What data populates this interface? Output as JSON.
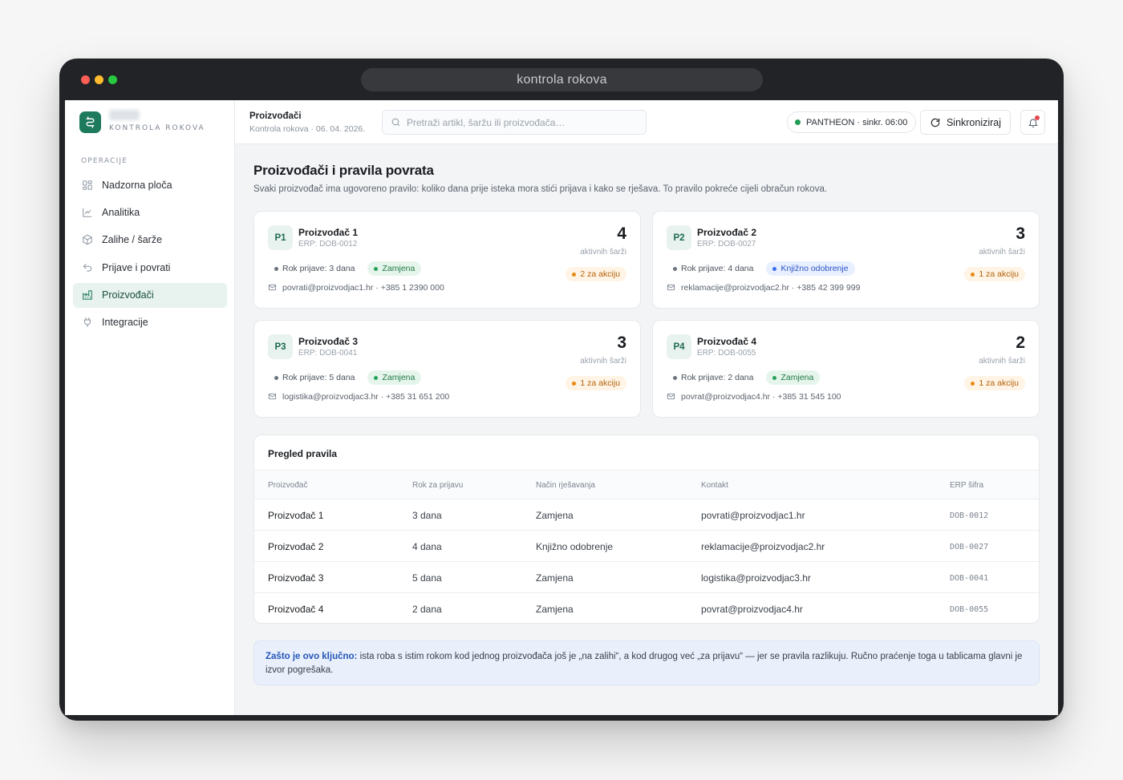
{
  "window": {
    "url": "kontrola rokova"
  },
  "brand": {
    "subtitle": "KONTROLA ROKOVA"
  },
  "sidebar": {
    "heading": "OPERACIJE",
    "items": [
      {
        "label": "Nadzorna ploča",
        "icon": "dashboard-grid-icon",
        "active": false
      },
      {
        "label": "Analitika",
        "icon": "chart-line-icon",
        "active": false
      },
      {
        "label": "Zalihe / šarže",
        "icon": "box-icon",
        "active": false
      },
      {
        "label": "Prijave i povrati",
        "icon": "return-arrow-icon",
        "active": false
      },
      {
        "label": "Proizvođači",
        "icon": "factory-icon",
        "active": true
      },
      {
        "label": "Integracije",
        "icon": "plug-icon",
        "active": false
      }
    ]
  },
  "topbar": {
    "title": "Proizvođači",
    "subtitle": "Kontrola rokova · 06. 04. 2026.",
    "search_placeholder": "Pretraži artikl, šaržu ili proizvođača…",
    "status": "PANTHEON · sinkr. 06:00",
    "sync_label": "Sinkroniziraj"
  },
  "page": {
    "title": "Proizvođači i pravila povrata",
    "description": "Svaki proizvođač ima ugovoreno pravilo: koliko dana prije isteka mora stići prijava i kako se rješava. To pravilo pokreće cijeli obračun rokova."
  },
  "cards": [
    {
      "tag": "P1",
      "name": "Proizvođač 1",
      "erp": "ERP: DOB-0012",
      "deadline": "Rok prijave: 3 dana",
      "method": "Zamjena",
      "method_color": "green",
      "contact": "povrati@proizvodjac1.hr · +385 1 2390 000",
      "count": "4",
      "count_label": "aktivnih šarži",
      "action": "2 za akciju"
    },
    {
      "tag": "P2",
      "name": "Proizvođač 2",
      "erp": "ERP: DOB-0027",
      "deadline": "Rok prijave: 4 dana",
      "method": "Knjižno odobrenje",
      "method_color": "blue",
      "contact": "reklamacije@proizvodjac2.hr · +385 42 399 999",
      "count": "3",
      "count_label": "aktivnih šarži",
      "action": "1 za akciju"
    },
    {
      "tag": "P3",
      "name": "Proizvođač 3",
      "erp": "ERP: DOB-0041",
      "deadline": "Rok prijave: 5 dana",
      "method": "Zamjena",
      "method_color": "green",
      "contact": "logistika@proizvodjac3.hr · +385 31 651 200",
      "count": "3",
      "count_label": "aktivnih šarži",
      "action": "1 za akciju"
    },
    {
      "tag": "P4",
      "name": "Proizvođač 4",
      "erp": "ERP: DOB-0055",
      "deadline": "Rok prijave: 2 dana",
      "method": "Zamjena",
      "method_color": "green",
      "contact": "povrat@proizvodjac4.hr · +385 31 545 100",
      "count": "2",
      "count_label": "aktivnih šarži",
      "action": "1 za akciju"
    }
  ],
  "rules_table": {
    "title": "Pregled pravila",
    "headers": [
      "Proizvođač",
      "Rok za prijavu",
      "Način rješavanja",
      "Kontakt",
      "ERP šifra"
    ],
    "rows": [
      [
        "Proizvođač 1",
        "3 dana",
        "Zamjena",
        "povrati@proizvodjac1.hr",
        "DOB-0012"
      ],
      [
        "Proizvođač 2",
        "4 dana",
        "Knjižno odobrenje",
        "reklamacije@proizvodjac2.hr",
        "DOB-0027"
      ],
      [
        "Proizvođač 3",
        "5 dana",
        "Zamjena",
        "logistika@proizvodjac3.hr",
        "DOB-0041"
      ],
      [
        "Proizvođač 4",
        "2 dana",
        "Zamjena",
        "povrat@proizvodjac4.hr",
        "DOB-0055"
      ]
    ]
  },
  "note": {
    "lead": "Zašto je ovo ključno:",
    "text": " ista roba s istim rokom kod jednog proizvođača još je „na zalihi“, a kod drugog već „za prijavu“ — jer se pravila razlikuju. Ručno praćenje toga u tablicama glavni je izvor pogrešaka."
  },
  "colors": {
    "brand": "#1d7a5c",
    "accent_blue": "#2456b8",
    "warning": "#e58a13",
    "success": "#25a35a"
  }
}
